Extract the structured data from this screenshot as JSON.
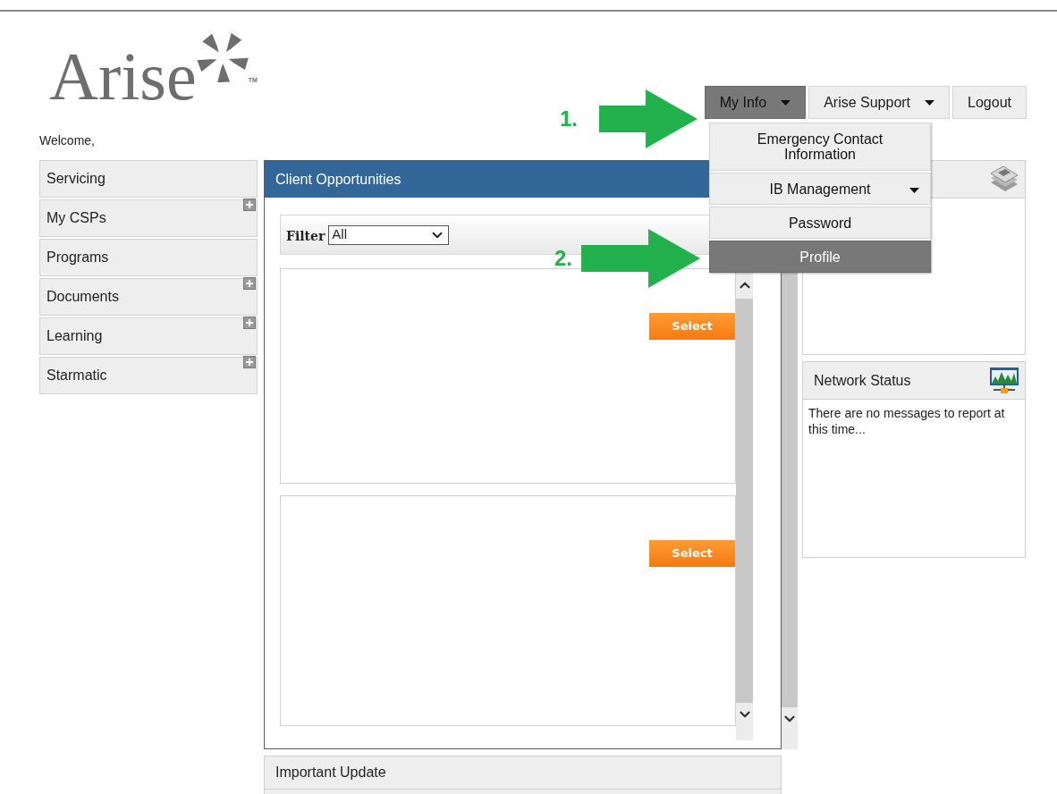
{
  "logo": {
    "name": "Arise",
    "trademark": "TM"
  },
  "nav": [
    {
      "label": "My Info",
      "has_caret": true,
      "expanded": true
    },
    {
      "label": "Arise Support",
      "has_caret": true,
      "expanded": false
    },
    {
      "label": "Logout",
      "has_caret": false,
      "expanded": false
    }
  ],
  "menu": [
    {
      "label": "Emergency Contact Information",
      "has_caret": false,
      "selected": false
    },
    {
      "label": "IB Management",
      "has_caret": true,
      "selected": false
    },
    {
      "label": "Password",
      "has_caret": false,
      "selected": false
    },
    {
      "label": "Profile",
      "has_caret": false,
      "selected": true
    }
  ],
  "welcome": "Welcome,",
  "sidebar": {
    "items": [
      {
        "label": "Servicing",
        "expandable": false
      },
      {
        "label": "My CSPs",
        "expandable": true
      },
      {
        "label": "Programs",
        "expandable": false
      },
      {
        "label": "Documents",
        "expandable": true
      },
      {
        "label": "Learning",
        "expandable": true
      },
      {
        "label": "Starmatic",
        "expandable": true
      }
    ]
  },
  "client_opportunities": {
    "title": "Client Opportunities",
    "filter": {
      "label": "Filter",
      "value": "All"
    },
    "cards": [
      {
        "button": "Select"
      },
      {
        "button": "Select"
      }
    ]
  },
  "important_update": {
    "title": "Important Update"
  },
  "network_status": {
    "title": "Network Status",
    "message": "There are no messages to report at this time..."
  },
  "annotations": [
    {
      "label": "1."
    },
    {
      "label": "2."
    }
  ]
}
